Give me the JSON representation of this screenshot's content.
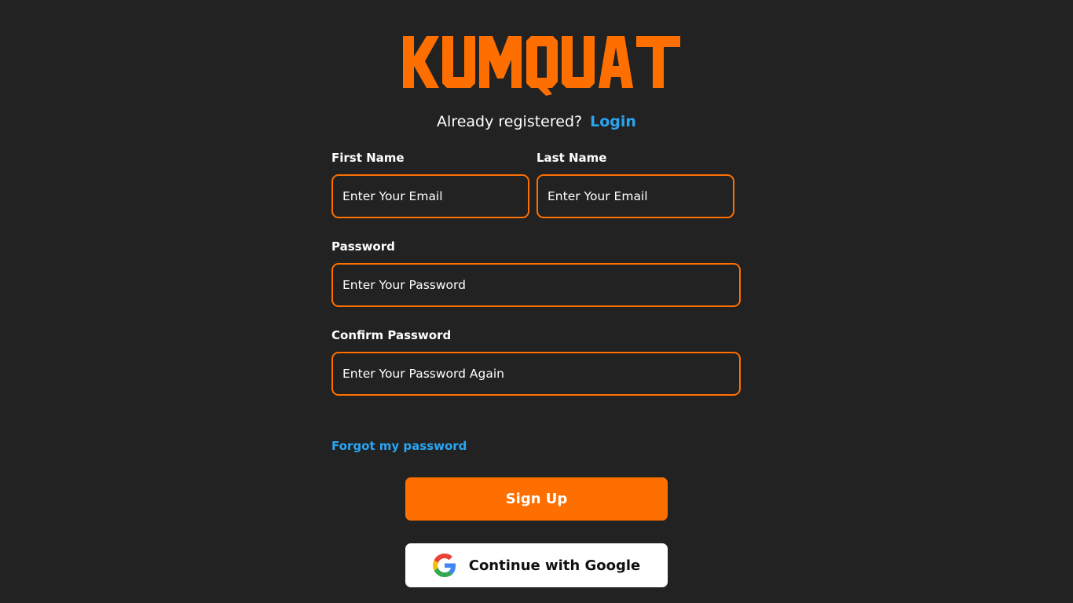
{
  "brand": {
    "logo_text": "KUMQUAT",
    "logo_color": "#ff6f00"
  },
  "login_prompt": {
    "text": "Already registered?",
    "link_label": "Login"
  },
  "form": {
    "first_name": {
      "label": "First Name",
      "placeholder": "Enter Your Email",
      "value": ""
    },
    "last_name": {
      "label": "Last Name",
      "placeholder": "Enter Your Email",
      "value": ""
    },
    "password": {
      "label": "Password",
      "placeholder": "Enter Your Password",
      "value": ""
    },
    "confirm_password": {
      "label": "Confirm Password",
      "placeholder": "Enter Your Password Again",
      "value": ""
    }
  },
  "forgot_password_label": "Forgot my password",
  "buttons": {
    "signup_label": "Sign Up",
    "google_label": "Continue with Google",
    "google_icon": "google-g-icon"
  },
  "colors": {
    "background": "#222222",
    "accent": "#ff6f00",
    "link": "#2aa5f3",
    "text": "#ffffff"
  }
}
